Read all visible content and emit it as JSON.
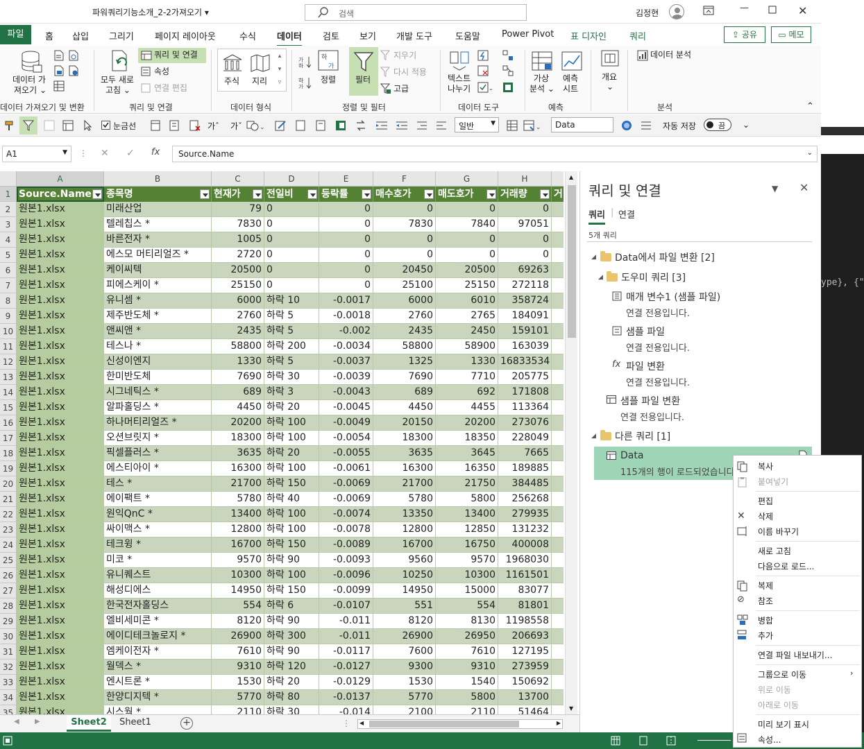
{
  "window": {
    "title": "파워쿼리기능소개_2-2가져오기",
    "user": "김정현"
  },
  "search": {
    "placeholder": "검색"
  },
  "ribbon_tabs": {
    "file": "파일",
    "home": "홈",
    "insert": "삽입",
    "draw": "그리기",
    "layout": "페이지 레이아웃",
    "formulas": "수식",
    "data": "데이터",
    "review": "검토",
    "view": "보기",
    "developer": "개발 도구",
    "help": "도움말",
    "powerpivot": "Power Pivot",
    "table_design": "표 디자인",
    "query": "쿼리"
  },
  "share": {
    "share_label": "공유",
    "comment_label": "메모"
  },
  "ribbon": {
    "get_data_line1": "데이터 가",
    "get_data_line2": "져오기",
    "refresh_all_line1": "모두 새로",
    "refresh_all_line2": "고침",
    "queries_connections": "쿼리 및 연결",
    "properties": "속성",
    "edit_links": "연결 편집",
    "stocks": "주식",
    "geography": "지리",
    "sort": "정렬",
    "filter": "필터",
    "clear": "지우기",
    "reapply": "다시 적용",
    "advanced": "고급",
    "text_to_columns_line1": "텍스트",
    "text_to_columns_line2": "나누기",
    "whatif_line1": "가상",
    "whatif_line2": "분석",
    "forecast_line1": "예측",
    "forecast_line2": "시트",
    "outline": "개요",
    "data_analysis": "데이터 분석",
    "group_get": "데이터 가져오기 및 변환",
    "group_queries": "쿼리 및 연결",
    "group_types": "데이터 형식",
    "group_sort": "정렬 및 필터",
    "group_tools": "데이터 도구",
    "group_forecast": "예측",
    "group_analysis": "분석"
  },
  "qat": {
    "gridlines": "눈금선",
    "format": "일반",
    "style_name": "Data",
    "autosave": "자동 저장",
    "autosave_state": "끔"
  },
  "formula_bar": {
    "cell_ref": "A1",
    "formula": "Source.Name"
  },
  "columns": [
    "A",
    "B",
    "C",
    "D",
    "E",
    "F",
    "G",
    "H"
  ],
  "table_headers": [
    "Source.Name",
    "종목명",
    "현재가",
    "전일비",
    "등락률",
    "매수호가",
    "매도호가",
    "거래량",
    "거"
  ],
  "rows": [
    [
      "원본1.xlsx",
      "미래산업",
      "79",
      "0",
      "0",
      "0",
      "0",
      "0"
    ],
    [
      "원본1.xlsx",
      "텔레칩스 *",
      "7830",
      "0",
      "0",
      "7830",
      "7840",
      "97051"
    ],
    [
      "원본1.xlsx",
      "바른전자 *",
      "1005",
      "0",
      "0",
      "0",
      "0",
      "0"
    ],
    [
      "원본1.xlsx",
      "에스모 머티리얼즈 *",
      "2720",
      "0",
      "0",
      "0",
      "0",
      "0"
    ],
    [
      "원본1.xlsx",
      "케이씨텍",
      "20500",
      "0",
      "0",
      "20450",
      "20500",
      "69263"
    ],
    [
      "원본1.xlsx",
      "피에스케이 *",
      "25150",
      "0",
      "0",
      "25100",
      "25150",
      "272118"
    ],
    [
      "원본1.xlsx",
      "유니셈 *",
      "6000",
      "하락 10",
      "-0.0017",
      "6000",
      "6010",
      "358724"
    ],
    [
      "원본1.xlsx",
      "제주반도체 *",
      "2760",
      "하락 5",
      "-0.0018",
      "2760",
      "2765",
      "184091"
    ],
    [
      "원본1.xlsx",
      "앤씨앤 *",
      "2435",
      "하락 5",
      "-0.002",
      "2435",
      "2450",
      "159101"
    ],
    [
      "원본1.xlsx",
      "테스나 *",
      "58800",
      "하락 200",
      "-0.0034",
      "58800",
      "58900",
      "163039"
    ],
    [
      "원본1.xlsx",
      "신성이엔지",
      "1330",
      "하락 5",
      "-0.0037",
      "1325",
      "1330",
      "16833534"
    ],
    [
      "원본1.xlsx",
      "한미반도체",
      "7690",
      "하락 30",
      "-0.0039",
      "7690",
      "7710",
      "205775"
    ],
    [
      "원본1.xlsx",
      "시그네틱스 *",
      "689",
      "하락 3",
      "-0.0043",
      "689",
      "692",
      "171808"
    ],
    [
      "원본1.xlsx",
      "알파홀딩스 *",
      "4450",
      "하락 20",
      "-0.0045",
      "4450",
      "4455",
      "113364"
    ],
    [
      "원본1.xlsx",
      "하나머티리얼즈 *",
      "20200",
      "하락 100",
      "-0.0049",
      "20150",
      "20200",
      "273076"
    ],
    [
      "원본1.xlsx",
      "오션브릿지 *",
      "18300",
      "하락 100",
      "-0.0054",
      "18300",
      "18350",
      "228049"
    ],
    [
      "원본1.xlsx",
      "픽셀플러스 *",
      "3635",
      "하락 20",
      "-0.0055",
      "3635",
      "3645",
      "7665"
    ],
    [
      "원본1.xlsx",
      "에스티아이 *",
      "16300",
      "하락 100",
      "-0.0061",
      "16300",
      "16350",
      "189885"
    ],
    [
      "원본1.xlsx",
      "테스 *",
      "21700",
      "하락 150",
      "-0.0069",
      "21700",
      "21750",
      "384485"
    ],
    [
      "원본1.xlsx",
      "에이팩트 *",
      "5780",
      "하락 40",
      "-0.0069",
      "5780",
      "5800",
      "256268"
    ],
    [
      "원본1.xlsx",
      "원익QnC *",
      "13400",
      "하락 100",
      "-0.0074",
      "13350",
      "13400",
      "279935"
    ],
    [
      "원본1.xlsx",
      "싸이맥스 *",
      "12800",
      "하락 100",
      "-0.0078",
      "12800",
      "12850",
      "131232"
    ],
    [
      "원본1.xlsx",
      "테크윙 *",
      "16700",
      "하락 150",
      "-0.0089",
      "16700",
      "16750",
      "400008"
    ],
    [
      "원본1.xlsx",
      "미코 *",
      "9570",
      "하락 90",
      "-0.0093",
      "9560",
      "9570",
      "1968030"
    ],
    [
      "원본1.xlsx",
      "유니퀘스트",
      "10300",
      "하락 100",
      "-0.0096",
      "10250",
      "10300",
      "1161501"
    ],
    [
      "원본1.xlsx",
      "해성디에스",
      "14950",
      "하락 150",
      "-0.0099",
      "14950",
      "15000",
      "83077"
    ],
    [
      "원본1.xlsx",
      "한국전자홀딩스",
      "554",
      "하락 6",
      "-0.0107",
      "551",
      "554",
      "81801"
    ],
    [
      "원본1.xlsx",
      "엘비세미콘 *",
      "8120",
      "하락 90",
      "-0.011",
      "8120",
      "8130",
      "1198558"
    ],
    [
      "원본1.xlsx",
      "에이디테크놀로지 *",
      "26900",
      "하락 300",
      "-0.011",
      "26900",
      "26950",
      "206693"
    ],
    [
      "원본1.xlsx",
      "엠케이전자 *",
      "7610",
      "하락 90",
      "-0.0117",
      "7600",
      "7610",
      "127195"
    ],
    [
      "원본1.xlsx",
      "월덱스 *",
      "9310",
      "하락 120",
      "-0.0127",
      "9300",
      "9310",
      "273959"
    ],
    [
      "원본1.xlsx",
      "엔시트론 *",
      "1530",
      "하락 20",
      "-0.0129",
      "1530",
      "1540",
      "150692"
    ],
    [
      "원본1.xlsx",
      "한양디지텍 *",
      "5770",
      "하락 80",
      "-0.0137",
      "5770",
      "5800",
      "13700"
    ],
    [
      "원본1.xlsx",
      "시스웍 *",
      "2110",
      "하락 30",
      "-0.014",
      "2100",
      "2110",
      "51464"
    ]
  ],
  "row_numbers": [
    "1",
    "2",
    "3",
    "4",
    "5",
    "6",
    "7",
    "8",
    "9",
    "10",
    "11",
    "12",
    "13",
    "14",
    "15",
    "16",
    "17",
    "18",
    "19",
    "20",
    "21",
    "22",
    "23",
    "24",
    "25",
    "26",
    "27",
    "28",
    "29",
    "30",
    "31",
    "32",
    "33",
    "34",
    "35"
  ],
  "sheets": {
    "active": "Sheet2",
    "other": "Sheet1"
  },
  "pane": {
    "title": "쿼리 및 연결",
    "tab_queries": "쿼리",
    "tab_connections": "연결",
    "count": "5개 쿼리",
    "group1": "Data에서 파일 변환 [2]",
    "group1_sub": "도우미 쿼리 [3]",
    "q1_name": "매개 변수1 (샘플 파일)",
    "q1_status": "연결 전용입니다.",
    "q2_name": "샘플 파일",
    "q2_status": "연결 전용입니다.",
    "q3_name": "파일 변환",
    "q3_status": "연결 전용입니다.",
    "q4_name": "샘플 파일 변환",
    "q4_status": "연결 전용입니다.",
    "group2": "다른 쿼리 [1]",
    "q5_name": "Data",
    "q5_status": "115개의 행이 로드되었습니다."
  },
  "background_code": "ype}, {\"",
  "context_menu": {
    "copy": "복사",
    "paste": "붙여넣기",
    "edit": "편집",
    "delete": "삭제",
    "rename": "이름 바꾸기",
    "refresh": "새로 고침",
    "load_to": "다음으로 로드...",
    "duplicate": "복제",
    "reference": "참조",
    "merge": "병합",
    "append": "추가",
    "export": "연결 파일 내보내기...",
    "move_group": "그룹으로 이동",
    "move_up": "위로 이동",
    "move_down": "아래로 이동",
    "show_peek": "미리 보기 표시",
    "properties": "속성..."
  },
  "colors": {
    "excel_green": "#217346",
    "table_header": "#548235",
    "row_band_dark": "#c6c6c6",
    "row_band_light": "#ffffff",
    "selected_query": "#9fd5b7",
    "data_band": "#b5cd9e"
  }
}
